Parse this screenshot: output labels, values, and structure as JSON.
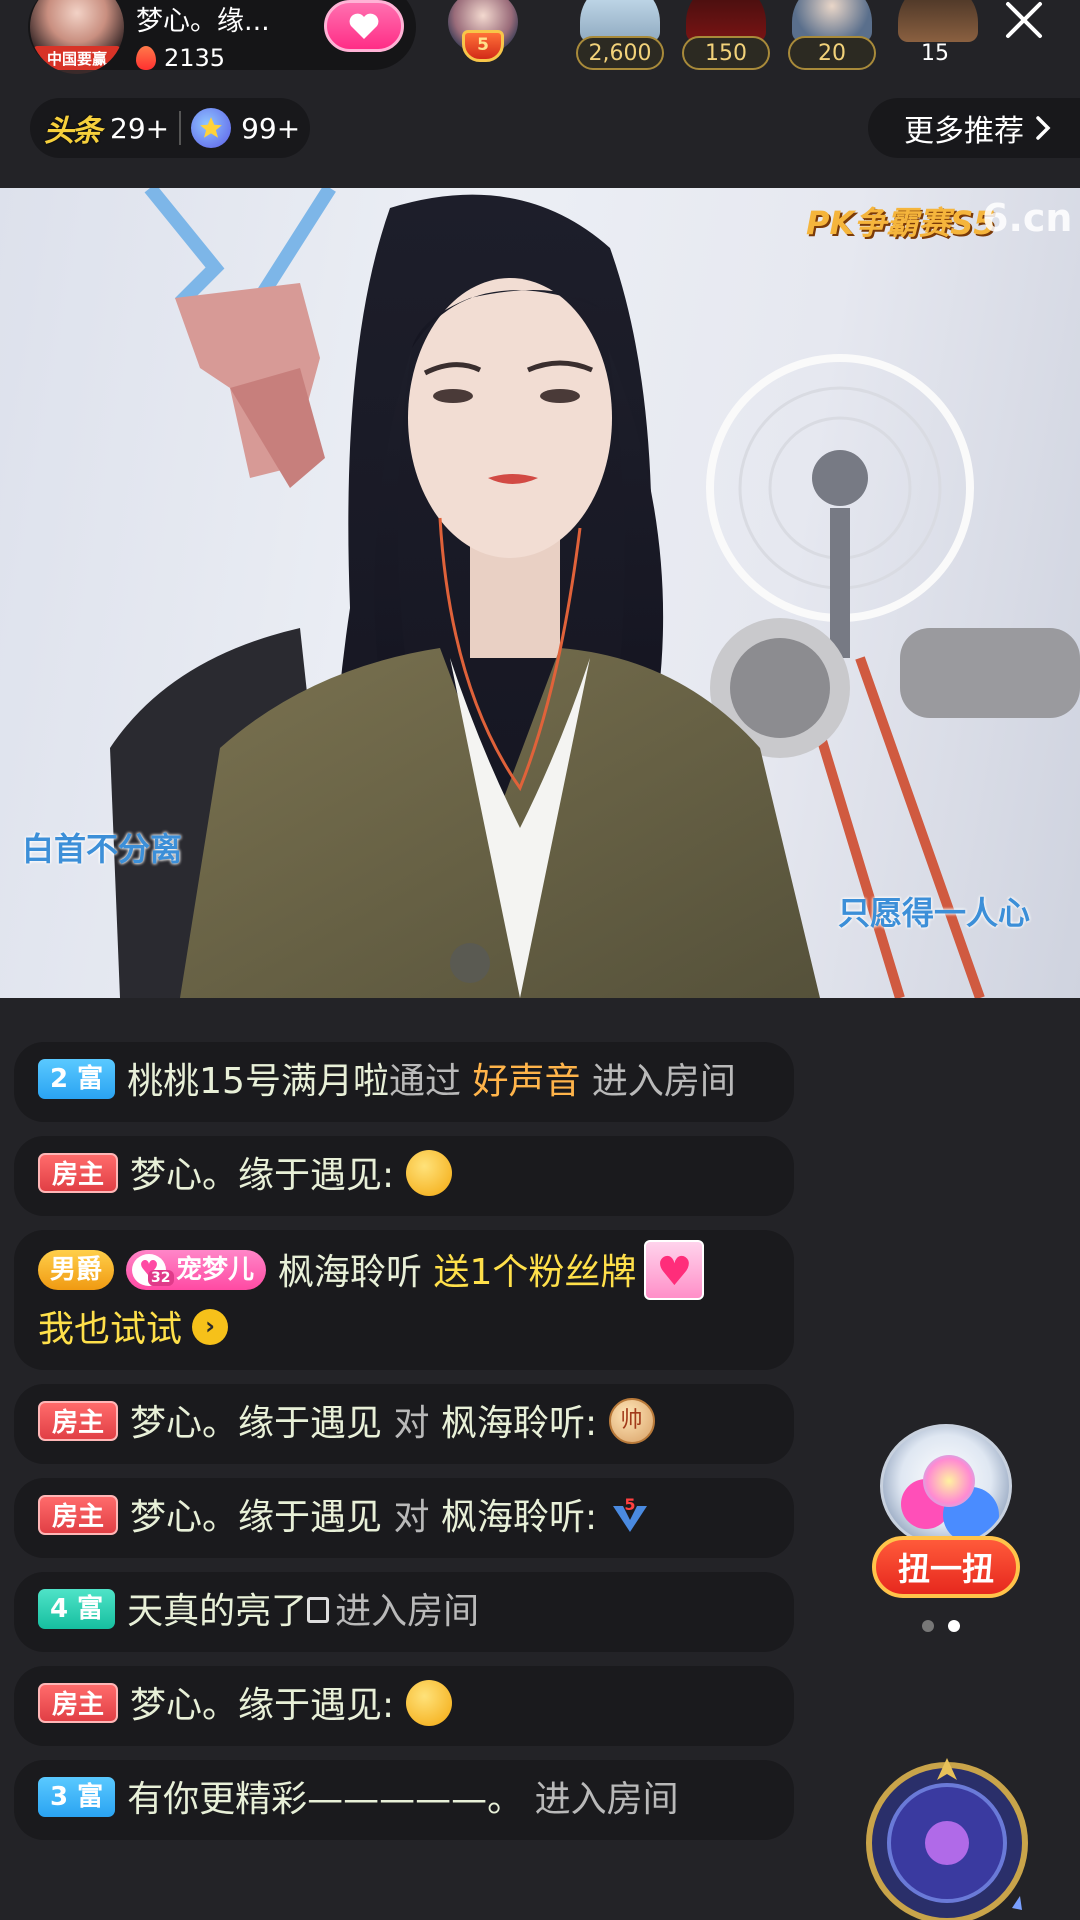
{
  "host": {
    "name": "梦心。缘...",
    "heat": "2135",
    "avatar_tag": "中国要赢"
  },
  "rank_badge": {
    "level": "5"
  },
  "viewers": [
    {
      "count": "2,600"
    },
    {
      "count": "150"
    },
    {
      "count": "20"
    },
    {
      "count": "15"
    }
  ],
  "badges": {
    "toutiao_label": "头条",
    "toutiao_count": "29+",
    "star_count": "99+"
  },
  "more_recommend": {
    "label": "更多推荐"
  },
  "video": {
    "watermark_event": "PK争霸赛S5",
    "watermark_site": "6.cn",
    "caption_left": "白首不分离",
    "caption_right": "只愿得一人心"
  },
  "chat": [
    {
      "tag": "2 富",
      "user": "桃桃15号满月啦",
      "via": "通过",
      "source": "好声音",
      "action": "进入房间"
    },
    {
      "tag": "房主",
      "user": "梦心。缘于遇见:"
    },
    {
      "tag1": "男爵",
      "tag2": "宠梦儿",
      "tag2_level": "32",
      "user": "枫海聆听",
      "gift": "送1个粉丝牌",
      "link": "我也试试"
    },
    {
      "tag": "房主",
      "user": "梦心。缘于遇见",
      "to": "对",
      "target": "枫海聆听:",
      "emoji": "帅"
    },
    {
      "tag": "房主",
      "user": "梦心。缘于遇见",
      "to": "对",
      "target": "枫海聆听:",
      "emoji_level": "5"
    },
    {
      "tag": "4 富",
      "user": "天真的亮了",
      "action": "进入房间"
    },
    {
      "tag": "房主",
      "user": "梦心。缘于遇见:"
    },
    {
      "tag": "3 富",
      "user": "有你更精彩—————。",
      "action": "进入房间"
    }
  ],
  "gacha": {
    "label": "扭一扭"
  },
  "pager": {
    "pages": 2,
    "active": 2
  },
  "colors": {
    "background": "#232327",
    "chat_bubble": "#1a1a1d",
    "host_tag": "#e13f45",
    "rich_tag_blue": "#2aa3f2",
    "rich_tag_teal": "#16bfa0",
    "accent_gold": "#ffb44a",
    "accent_yellow": "#ffe04a",
    "follow_pink": "#ff2d86"
  }
}
